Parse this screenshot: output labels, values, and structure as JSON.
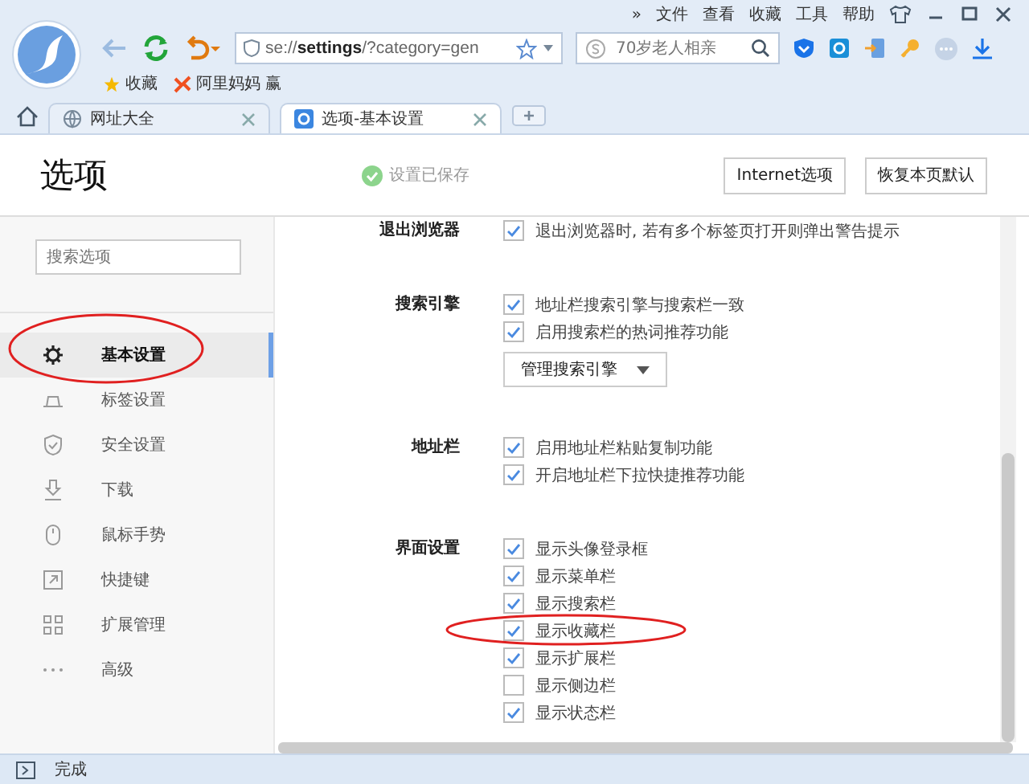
{
  "menu": [
    "»",
    "文件",
    "查看",
    "收藏",
    "工具",
    "帮助"
  ],
  "address": {
    "value": "se://**settings**/?category=gen"
  },
  "search": {
    "placeholder": "70岁老人相亲"
  },
  "bookmarks": [
    {
      "label": "收藏",
      "kind": "star"
    },
    {
      "label": "阿里妈妈 赢",
      "kind": "brand"
    }
  ],
  "tabs": [
    {
      "label": "网址大全",
      "selected": false,
      "kind": "globe"
    },
    {
      "label": "选项-基本设置",
      "selected": true,
      "kind": "gear"
    }
  ],
  "page": {
    "title": "选项",
    "saved_notice": "设置已保存",
    "buttons": [
      "Internet选项",
      "恢复本页默认"
    ]
  },
  "sidebar": {
    "search": {
      "placeholder": "搜索选项"
    },
    "items": [
      {
        "label": "基本设置",
        "selected": true,
        "kind": "gear"
      },
      {
        "label": "标签设置",
        "selected": false,
        "kind": "tab"
      },
      {
        "label": "安全设置",
        "selected": false,
        "kind": "shield"
      },
      {
        "label": "下载",
        "selected": false,
        "kind": "download"
      },
      {
        "label": "鼠标手势",
        "selected": false,
        "kind": "mouse"
      },
      {
        "label": "快捷键",
        "selected": false,
        "kind": "shortcut"
      },
      {
        "label": "扩展管理",
        "selected": false,
        "kind": "grid"
      },
      {
        "label": "高级",
        "selected": false,
        "kind": "dots"
      }
    ]
  },
  "sections": [
    {
      "label": "退出浏览器",
      "options": [
        {
          "label": "退出浏览器时, 若有多个标签页打开则弹出警告提示",
          "checked": true
        }
      ]
    },
    {
      "label": "搜索引擎",
      "options": [
        {
          "label": "地址栏搜索引擎与搜索栏一致",
          "checked": true
        },
        {
          "label": "启用搜索栏的热词推荐功能",
          "checked": true
        }
      ],
      "dropdown": "管理搜索引擎"
    },
    {
      "label": "地址栏",
      "options": [
        {
          "label": "启用地址栏粘贴复制功能",
          "checked": true
        },
        {
          "label": "开启地址栏下拉快捷推荐功能",
          "checked": true
        }
      ]
    },
    {
      "label": "界面设置",
      "options": [
        {
          "label": "显示头像登录框",
          "checked": true
        },
        {
          "label": "显示菜单栏",
          "checked": true
        },
        {
          "label": "显示搜索栏",
          "checked": true
        },
        {
          "label": "显示收藏栏",
          "checked": true
        },
        {
          "label": "显示扩展栏",
          "checked": true
        },
        {
          "label": "显示侧边栏",
          "checked": false
        },
        {
          "label": "显示状态栏",
          "checked": true
        }
      ]
    }
  ],
  "status_bar": {
    "text": "完成"
  }
}
